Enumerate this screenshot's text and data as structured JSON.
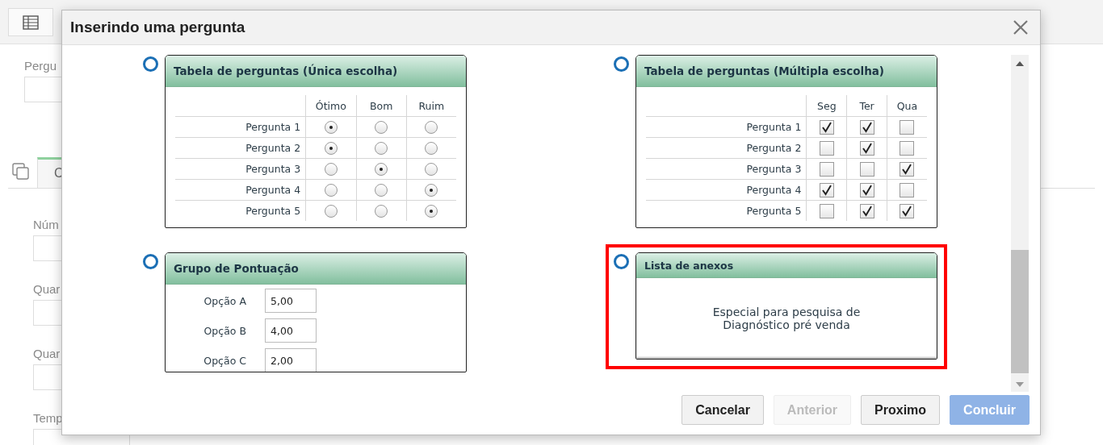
{
  "page": {
    "fields": [
      {
        "label": "Pergu"
      }
    ],
    "tab": {
      "label": "C"
    },
    "tab_fields": [
      {
        "label": "Núm"
      },
      {
        "label": "Quar"
      },
      {
        "label": "Quar"
      },
      {
        "label": "Temp"
      }
    ]
  },
  "dialog": {
    "title": "Inserindo uma pergunta",
    "options": [
      {
        "kind": "single_choice_table",
        "selected": false,
        "highlighted": false,
        "title": "Tabela de perguntas (Única escolha)",
        "columns": [
          "Ótimo",
          "Bom",
          "Ruim"
        ],
        "rows": [
          {
            "label": "Pergunta 1",
            "choices": [
              true,
              false,
              false
            ]
          },
          {
            "label": "Pergunta 2",
            "choices": [
              true,
              false,
              false
            ]
          },
          {
            "label": "Pergunta 3",
            "choices": [
              false,
              true,
              false
            ]
          },
          {
            "label": "Pergunta 4",
            "choices": [
              false,
              false,
              true
            ]
          },
          {
            "label": "Pergunta 5",
            "choices": [
              false,
              false,
              true
            ]
          }
        ]
      },
      {
        "kind": "multiple_choice_table",
        "selected": false,
        "highlighted": false,
        "title": "Tabela de perguntas (Múltipla escolha)",
        "columns": [
          "Seg",
          "Ter",
          "Qua"
        ],
        "rows": [
          {
            "label": "Pergunta 1",
            "choices": [
              true,
              true,
              false
            ]
          },
          {
            "label": "Pergunta 2",
            "choices": [
              false,
              true,
              false
            ]
          },
          {
            "label": "Pergunta 3",
            "choices": [
              false,
              false,
              true
            ]
          },
          {
            "label": "Pergunta 4",
            "choices": [
              true,
              true,
              false
            ]
          },
          {
            "label": "Pergunta 5",
            "choices": [
              false,
              true,
              true
            ]
          }
        ]
      },
      {
        "kind": "score_group",
        "selected": false,
        "highlighted": false,
        "title": "Grupo de Pontuação",
        "items": [
          {
            "label": "Opção A",
            "value": "5,00"
          },
          {
            "label": "Opção B",
            "value": "4,00"
          },
          {
            "label": "Opção C",
            "value": "2,00"
          }
        ]
      },
      {
        "kind": "attachment_list",
        "selected": false,
        "highlighted": true,
        "title": "Lista de anexos",
        "text": "Especial para pesquisa de Diagnóstico pré venda"
      }
    ],
    "buttons": [
      {
        "label": "Cancelar",
        "kind": "default",
        "disabled": false
      },
      {
        "label": "Anterior",
        "kind": "default",
        "disabled": true
      },
      {
        "label": "Proximo",
        "kind": "default",
        "disabled": false
      },
      {
        "label": "Concluir",
        "kind": "primary",
        "disabled": true
      }
    ]
  }
}
